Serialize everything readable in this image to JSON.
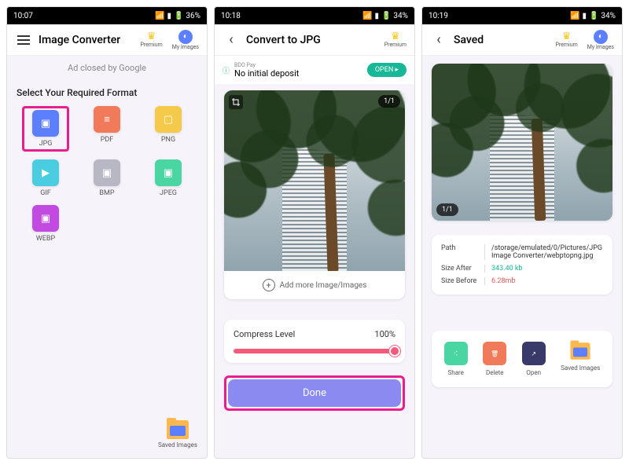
{
  "screen1": {
    "time": "10:07",
    "battery": "36%",
    "title": "Image Converter",
    "premium_label": "Premium",
    "myimages_label": "My Images",
    "ad_text": "Ad closed by Google",
    "section_title": "Select Your Required Format",
    "formats": [
      {
        "label": "JPG",
        "color": "#5b7fff"
      },
      {
        "label": "PDF",
        "color": "#f07a5a"
      },
      {
        "label": "PNG",
        "color": "#f5c94a"
      },
      {
        "label": "GIF",
        "color": "#4acde0"
      },
      {
        "label": "BMP",
        "color": "#b8b8c4"
      },
      {
        "label": "JPEG",
        "color": "#4ad6a2"
      },
      {
        "label": "WEBP",
        "color": "#c24ae0"
      }
    ],
    "saved_images_label": "Saved Images"
  },
  "screen2": {
    "time": "10:18",
    "battery": "34%",
    "title": "Convert to JPG",
    "premium_label": "Premium",
    "ad_top": "BDO Pay",
    "ad_main": "No initial deposit",
    "open_label": "OPEN",
    "counter": "1/1",
    "add_more_label": "Add more Image/Images",
    "compress_label": "Compress Level",
    "compress_value": "100%",
    "done_label": "Done"
  },
  "screen3": {
    "time": "10:19",
    "battery": "34%",
    "title": "Saved",
    "premium_label": "Premium",
    "myimages_label": "My Images",
    "counter": "1/1",
    "path_label": "Path",
    "path_value": "/storage/emulated/0/Pictures/JPG Image Converter/webptopng.jpg",
    "size_after_label": "Size After",
    "size_after_value": "343.40 kb",
    "size_before_label": "Size Before",
    "size_before_value": "6.28mb",
    "actions": {
      "share": "Share",
      "delete": "Delete",
      "open": "Open",
      "saved": "Saved Images"
    }
  }
}
